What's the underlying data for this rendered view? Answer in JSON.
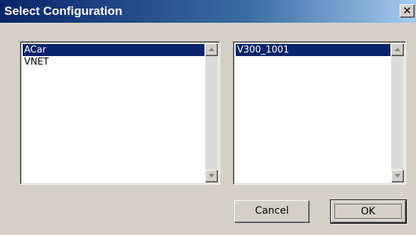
{
  "window": {
    "title": "Select Configuration",
    "close_glyph": "✕"
  },
  "icons": {
    "close": "close-icon",
    "scroll_up": "scroll-up-arrow-icon",
    "scroll_down": "scroll-down-arrow-icon"
  },
  "left_list": {
    "items": [
      {
        "label": "ACar",
        "selected": true
      },
      {
        "label": "VNET",
        "selected": false
      }
    ]
  },
  "right_list": {
    "items": [
      {
        "label": "V300_1001",
        "selected": true
      }
    ]
  },
  "buttons": {
    "cancel_label": "Cancel",
    "ok_label": "OK"
  },
  "colors": {
    "title_gradient_start": "#0a246a",
    "title_gradient_end": "#a6caf0",
    "selection_bg": "#0a246a",
    "face": "#d4d0c8"
  }
}
